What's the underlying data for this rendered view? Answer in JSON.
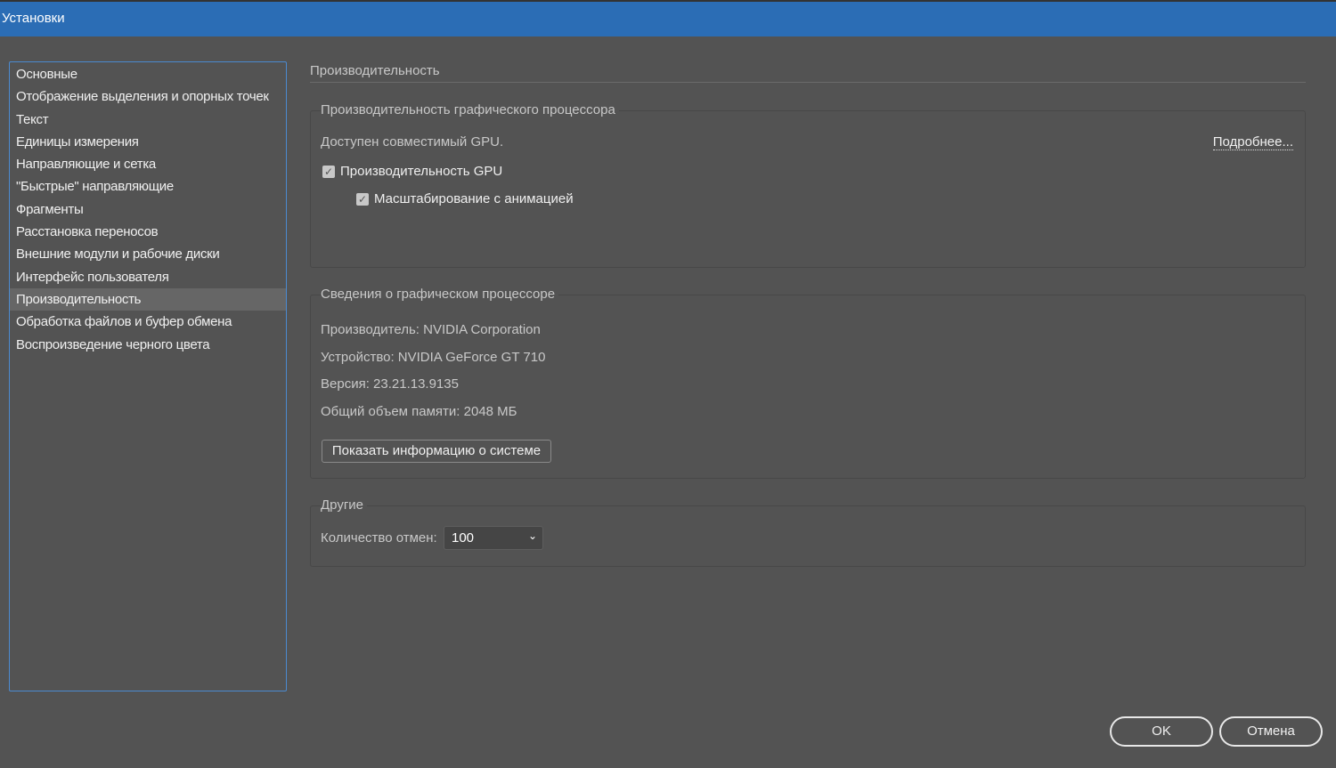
{
  "window": {
    "title": "Установки"
  },
  "sidebar": {
    "items": [
      {
        "label": "Основные"
      },
      {
        "label": "Отображение выделения и опорных точек"
      },
      {
        "label": "Текст"
      },
      {
        "label": "Единицы измерения"
      },
      {
        "label": "Направляющие и сетка"
      },
      {
        "label": "\"Быстрые\" направляющие"
      },
      {
        "label": "Фрагменты"
      },
      {
        "label": "Расстановка переносов"
      },
      {
        "label": "Внешние модули и рабочие диски"
      },
      {
        "label": "Интерфейс пользователя"
      },
      {
        "label": "Производительность"
      },
      {
        "label": "Обработка файлов и буфер обмена"
      },
      {
        "label": "Воспроизведение черного цвета"
      }
    ],
    "selected": "Производительность"
  },
  "main": {
    "title": "Производительность",
    "gpu_perf": {
      "legend": "Производительность графического процессора",
      "status": "Доступен совместимый GPU.",
      "more_link": "Подробнее...",
      "gpu_checkbox": {
        "label": "Производительность GPU",
        "checked": true
      },
      "anim_checkbox": {
        "label": "Масштабирование с анимацией",
        "checked": true
      }
    },
    "gpu_info": {
      "legend": "Сведения о графическом процессоре",
      "vendor": "Производитель: NVIDIA Corporation",
      "device": "Устройство: NVIDIA GeForce GT 710",
      "version": "Версия: 23.21.13.9135",
      "memory": "Общий объем памяти: 2048 МБ",
      "sysinfo_button": "Показать информацию о системе"
    },
    "other": {
      "legend": "Другие",
      "undo_label": "Количество отмен:",
      "undo_value": "100"
    }
  },
  "footer": {
    "ok": "OK",
    "cancel": "Отмена"
  },
  "colors": {
    "titlebar": "#2b6db5",
    "background": "#535353",
    "selected": "#666666"
  }
}
